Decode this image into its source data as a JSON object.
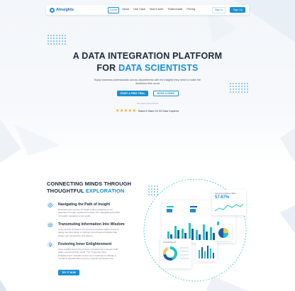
{
  "nav": {
    "brand": "AInsights",
    "links": [
      "Home",
      "About",
      "Use Case",
      "How it work",
      "Testimonials",
      "Pricing"
    ],
    "signin": "Sign in",
    "signup": "Sign Up"
  },
  "hero": {
    "title_line1": "A DATA INTEGRATION PLATFORM",
    "title_line2_prefix": "FOR",
    "title_line2_accent": "DATA SCIENTISTS",
    "subtitle": "Equip business professionals across departments with the insights they need to make the decisions that count",
    "cta_primary": "START A FREE TRIAL",
    "cta_secondary": "BOOK A DEMO",
    "note": "No credit card required",
    "rating_text": "Rated 5 Stars On G2 Data Capterra",
    "rating_stars": 5
  },
  "section": {
    "title_line1": "CONNECTING MINDS THROUGH",
    "title_line2_prefix": "THOUGHTFUL",
    "title_line2_accent": "EXPLORATION",
    "features": [
      {
        "icon": "compass-icon",
        "title": "Navigating the Path of Insight",
        "description": "Embracing the journey of insight is like embarking on an adventure through uncharted territory. The \"Navigating the Path of Insight\" visualizes a sure guide."
      },
      {
        "icon": "book-icon",
        "title": "Transmuting Information Into Wisdom",
        "description": "In the pursuit of wisdom, the process of transmutation involves taking raw information & refining it into profound insights that shape your perspective and actions."
      },
      {
        "icon": "lightbulb-icon",
        "title": "Fostering Inner Enlightenment",
        "description": "Inner enlightenment the process of awakening to deeper truth within oneself and the world. The \"Fostering Inner Enlightenment\" checklist serves as a roadmap to cultivate a mindful & transformative journey towards self-awareness."
      }
    ],
    "cta": "TRY IT NOW"
  },
  "dashboard": {
    "stat_card_title": "Cloud Compliance Rate",
    "stat_card_value": "57.67%",
    "donut_card_title": "Overall Report"
  },
  "colors": {
    "accent": "#1b8fd2",
    "heading": "#1c2a3f",
    "star": "#f2a71b",
    "teal": "#27c3c0",
    "navy": "#1a5da8"
  }
}
